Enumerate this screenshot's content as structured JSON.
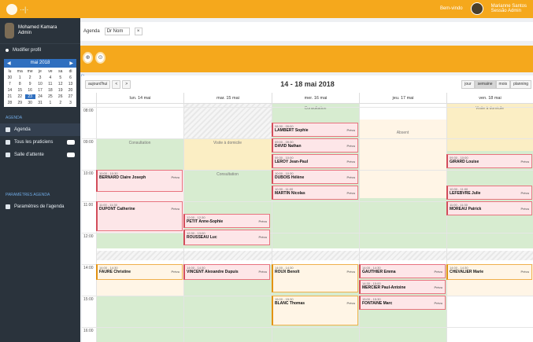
{
  "header": {
    "brand": "·-|·",
    "right_label": "Bem-vindo",
    "user_line1": "Marianne Santos",
    "user_line2": "Sessão Admin"
  },
  "sidebar": {
    "user_name_1": "Mohamed Kamara",
    "user_name_2": "Admin",
    "main_item": "Modifier profil",
    "calendar": {
      "month": "mai 2018",
      "weekdays": [
        "lu",
        "ma",
        "me",
        "je",
        "ve",
        "sa",
        "di"
      ],
      "days": [
        "30",
        "1",
        "2",
        "3",
        "4",
        "5",
        "6",
        "7",
        "8",
        "9",
        "10",
        "11",
        "12",
        "13",
        "14",
        "15",
        "16",
        "17",
        "18",
        "19",
        "20",
        "21",
        "22",
        "23",
        "24",
        "25",
        "26",
        "27",
        "28",
        "29",
        "30",
        "31",
        "1",
        "2",
        "3"
      ],
      "selected": "23"
    },
    "section1": "AGENDA",
    "items": [
      {
        "label": "Agenda",
        "active": true
      },
      {
        "label": "Tous les praticiens",
        "toggle": true
      },
      {
        "label": "Salle d'attente",
        "toggle": true
      }
    ],
    "section2": "PARAMÈTRES AGENDA",
    "settings_item": "Paramètres de l'agenda"
  },
  "agenda_bar": {
    "label": "Agenda",
    "selected": "Dr Nom",
    "clear": "×"
  },
  "actions": {
    "btn1": "⊕",
    "btn2": "⊙",
    "abbr": "Dr"
  },
  "calendar": {
    "today_label": "aujourd'hui",
    "prev": "<",
    "next": ">",
    "title": "14 - 18 mai 2018",
    "views": [
      "jour",
      "semaine",
      "mois",
      "planning"
    ],
    "active_view": "semaine",
    "days": [
      "lun. 14 mai",
      "mar. 15 mai",
      "mer. 16 mai",
      "jeu. 17 mai",
      "ven. 18 mai"
    ],
    "times": [
      "08:00",
      "09:00",
      "10:00",
      "11:00",
      "12:00",
      "14:00",
      "15:00",
      "16:00"
    ],
    "blocks": {
      "consult": "Consultation",
      "absent": "Absent",
      "visite": "Visite à domicile"
    },
    "events": [
      {
        "time": "08:30 - 09:00",
        "name": "LAMBERT Sophie",
        "status": "Prévu"
      },
      {
        "time": "09:00 - 09:30",
        "name": "DAVID Nathan",
        "status": "Prévu"
      },
      {
        "time": "09:30 - 10:00",
        "name": "LEROY Jean-Paul",
        "status": "Prévu"
      },
      {
        "time": "10:00 - 10:30",
        "name": "DUBOIS Hélène",
        "status": "Prévu"
      },
      {
        "time": "10:30 - 11:00",
        "name": "MARTIN Nicolas",
        "status": "Prévu"
      },
      {
        "time": "10:00 - 10:30",
        "name": "BERNARD Claire Joseph",
        "status": "Prévu"
      },
      {
        "time": "11:00 - 11:30",
        "name": "DUPONT Catherine",
        "status": "Prévu"
      },
      {
        "time": "12:00 - 12:30",
        "name": "PETIT Anne-Sophie",
        "status": "Prévu"
      },
      {
        "time": "12:30 - 13:00",
        "name": "ROUSSEAU Luc",
        "status": "Prévu"
      },
      {
        "time": "09:30 - 10:00",
        "name": "GIRARD Louise",
        "status": "Prévu"
      },
      {
        "time": "10:30 - 11:00",
        "name": "LEFEBVRE Julie",
        "status": "Prévu"
      },
      {
        "time": "11:00 - 11:30",
        "name": "MOREAU Patrick",
        "status": "Prévu"
      },
      {
        "time": "14:00 - 14:30",
        "name": "FAURE Christine",
        "status": "Prévu"
      },
      {
        "time": "14:00 - 14:30",
        "name": "VINCENT Alexandre Dupuis",
        "status": "Prévu"
      },
      {
        "time": "14:00 - 14:30",
        "name": "ROUX Benoît",
        "status": "Prévu"
      },
      {
        "time": "15:00 - 15:30",
        "name": "BLANC Thomas",
        "status": "Prévu"
      },
      {
        "time": "14:00 - 14:30",
        "name": "GAUTHIER Emma",
        "status": "Prévu"
      },
      {
        "time": "14:30 - 15:00",
        "name": "MERCIER Paul-Antoine",
        "status": "Prévu"
      },
      {
        "time": "15:00 - 15:30",
        "name": "FONTAINE Marc",
        "status": "Prévu"
      },
      {
        "time": "14:00 - 14:30",
        "name": "CHEVALIER Marie",
        "status": "Prévu"
      }
    ]
  },
  "colors": {
    "accent": "#f5a81c",
    "sidebar": "#2a333c",
    "event_border": "#d24d5b",
    "consult_bg": "#d7ecd0",
    "absent_bg": "#fbeec4"
  }
}
